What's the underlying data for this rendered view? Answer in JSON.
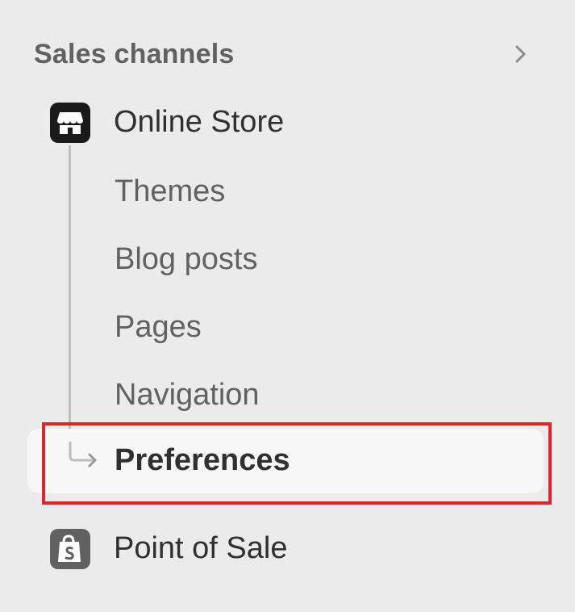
{
  "section": {
    "title": "Sales channels",
    "chevron_icon": "chevron-right-icon"
  },
  "online_store": {
    "label": "Online Store",
    "icon": "store-icon",
    "sub_items": [
      {
        "label": "Themes"
      },
      {
        "label": "Blog posts"
      },
      {
        "label": "Pages"
      },
      {
        "label": "Navigation"
      },
      {
        "label": "Preferences",
        "selected": true
      }
    ]
  },
  "point_of_sale": {
    "label": "Point of Sale",
    "icon": "shopping-bag-icon"
  },
  "colors": {
    "background": "#ebebeb",
    "selected_bg": "#f7f7f7",
    "highlight_border": "#e8202a",
    "text_primary": "#303030",
    "text_secondary": "#616161"
  }
}
